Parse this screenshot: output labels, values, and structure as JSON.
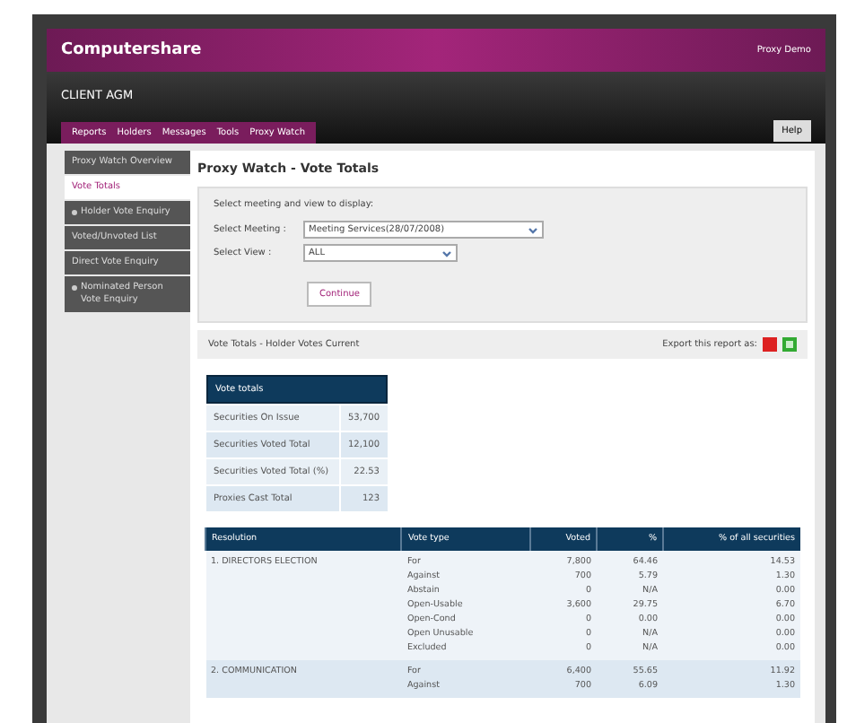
{
  "brand": {
    "name": "Computershare",
    "user": "Proxy Demo"
  },
  "client": "CLIENT AGM",
  "nav": [
    {
      "label": "Reports"
    },
    {
      "label": "Holders"
    },
    {
      "label": "Messages"
    },
    {
      "label": "Tools"
    },
    {
      "label": "Proxy Watch"
    }
  ],
  "help": "Help",
  "sidebar": {
    "items": [
      {
        "label": "Proxy Watch Overview",
        "selected": false,
        "expandable": false
      },
      {
        "label": "Vote Totals",
        "selected": true,
        "expandable": false
      },
      {
        "label": "Holder Vote Enquiry",
        "selected": false,
        "expandable": true
      },
      {
        "label": "Voted/Unvoted List",
        "selected": false,
        "expandable": false
      },
      {
        "label": "Direct Vote Enquiry",
        "selected": false,
        "expandable": false
      },
      {
        "label": "Nominated Person Vote Enquiry",
        "selected": false,
        "expandable": true
      }
    ]
  },
  "page_title": "Proxy Watch - Vote Totals",
  "selector": {
    "prompt": "Select meeting and view to display:",
    "meeting_label": "Select Meeting :",
    "meeting_value": "Meeting Services(28/07/2008)",
    "view_label": "Select View :",
    "view_value": "ALL",
    "button": "Continue"
  },
  "report": {
    "title": "Vote Totals - Holder Votes Current",
    "export_label": "Export this report as:"
  },
  "totals": {
    "heading": "Vote totals",
    "rows": [
      {
        "label": "Securities On Issue",
        "value": "53,700"
      },
      {
        "label": "Securities Voted Total",
        "value": "12,100"
      },
      {
        "label": "Securities Voted Total (%)",
        "value": "22.53"
      },
      {
        "label": "Proxies Cast Total",
        "value": "123"
      }
    ]
  },
  "table": {
    "columns": [
      "Resolution",
      "Vote type",
      "Voted",
      "%",
      "% of all securities"
    ],
    "groups": [
      {
        "resolution": "1. DIRECTORS ELECTION",
        "rows": [
          [
            "For",
            "7,800",
            "64.46",
            "14.53"
          ],
          [
            "Against",
            "700",
            "5.79",
            "1.30"
          ],
          [
            "Abstain",
            "0",
            "N/A",
            "0.00"
          ],
          [
            "Open-Usable",
            "3,600",
            "29.75",
            "6.70"
          ],
          [
            "Open-Cond",
            "0",
            "0.00",
            "0.00"
          ],
          [
            "Open Unusable",
            "0",
            "N/A",
            "0.00"
          ],
          [
            "Excluded",
            "0",
            "N/A",
            "0.00"
          ]
        ]
      },
      {
        "resolution": "2. COMMUNICATION",
        "rows": [
          [
            "For",
            "6,400",
            "55.65",
            "11.92"
          ],
          [
            "Against",
            "700",
            "6.09",
            "1.30"
          ]
        ]
      }
    ]
  }
}
